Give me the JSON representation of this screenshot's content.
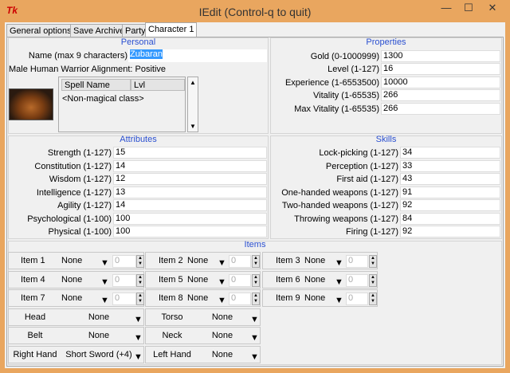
{
  "window": {
    "title": "IEdit    (Control-q to quit)",
    "app_icon": "Tk",
    "minimize": "—",
    "maximize": "☐",
    "close": "✕"
  },
  "tabs": [
    {
      "label": "General options"
    },
    {
      "label": "Save Archive"
    },
    {
      "label": "Party"
    },
    {
      "label": "Character 1",
      "active": true
    }
  ],
  "personal": {
    "title": "Personal",
    "name_label": "Name (max 9 characters)",
    "name_value": "Zubaran",
    "description": "Male Human Warrior Alignment: Positive",
    "spell_headers": [
      "Spell Name",
      "Lvl"
    ],
    "spell_rows": [
      "<Non-magical class>"
    ]
  },
  "properties": {
    "title": "Properties",
    "rows": [
      {
        "label": "Gold (0-1000999)",
        "value": "1300"
      },
      {
        "label": "Level (1-127)",
        "value": "16"
      },
      {
        "label": "Experience (1-6553500)",
        "value": "10000"
      },
      {
        "label": "Vitality (1-65535)",
        "value": "266"
      },
      {
        "label": "Max Vitality (1-65535)",
        "value": "266"
      }
    ]
  },
  "attributes": {
    "title": "Attributes",
    "rows": [
      {
        "label": "Strength (1-127)",
        "value": "15"
      },
      {
        "label": "Constitution (1-127)",
        "value": "14"
      },
      {
        "label": "Wisdom (1-127)",
        "value": "12"
      },
      {
        "label": "Intelligence (1-127)",
        "value": "13"
      },
      {
        "label": "Agility (1-127)",
        "value": "14"
      },
      {
        "label": "Psychological (1-100)",
        "value": "100"
      },
      {
        "label": "Physical (1-100)",
        "value": "100"
      }
    ]
  },
  "skills": {
    "title": "Skills",
    "rows": [
      {
        "label": "Lock-picking (1-127)",
        "value": "34"
      },
      {
        "label": "Perception (1-127)",
        "value": "33"
      },
      {
        "label": "First aid (1-127)",
        "value": "43"
      },
      {
        "label": "One-handed weapons (1-127)",
        "value": "91"
      },
      {
        "label": "Two-handed weapons (1-127)",
        "value": "92"
      },
      {
        "label": "Throwing weapons (1-127)",
        "value": "84"
      },
      {
        "label": "Firing (1-127)",
        "value": "92"
      }
    ]
  },
  "items": {
    "title": "Items",
    "slots": [
      {
        "label": "Item 1",
        "value": "None",
        "qty": "0"
      },
      {
        "label": "Item 2",
        "value": "None",
        "qty": "0"
      },
      {
        "label": "Item 3",
        "value": "None",
        "qty": "0"
      },
      {
        "label": "Item 4",
        "value": "None",
        "qty": "0"
      },
      {
        "label": "Item 5",
        "value": "None",
        "qty": "0"
      },
      {
        "label": "Item 6",
        "value": "None",
        "qty": "0"
      },
      {
        "label": "Item 7",
        "value": "None",
        "qty": "0"
      },
      {
        "label": "Item 8",
        "value": "None",
        "qty": "0"
      },
      {
        "label": "Item 9",
        "value": "None",
        "qty": "0"
      }
    ],
    "equipment": [
      {
        "label": "Head",
        "value": "None"
      },
      {
        "label": "Torso",
        "value": "None"
      },
      {
        "label": "Belt",
        "value": "None"
      },
      {
        "label": "Neck",
        "value": "None"
      },
      {
        "label": "Right Hand",
        "value": "Short Sword (+4)"
      },
      {
        "label": "Left Hand",
        "value": "None"
      }
    ]
  }
}
